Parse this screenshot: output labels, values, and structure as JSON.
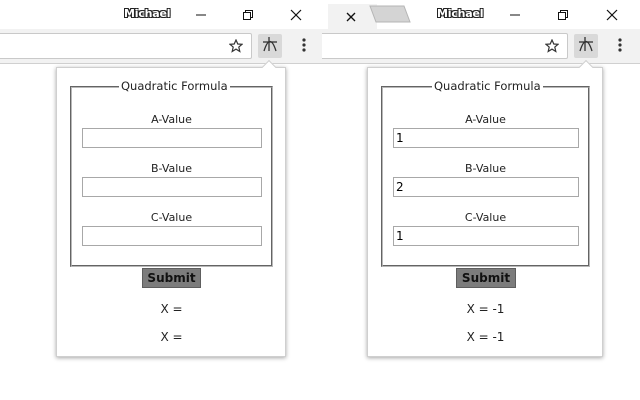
{
  "left_window": {
    "user_name": "Michael",
    "popup": {
      "legend": "Quadratic Formula",
      "a_label": "A-Value",
      "b_label": "B-Value",
      "c_label": "C-Value",
      "a_value": "",
      "b_value": "",
      "c_value": "",
      "submit_label": "Submit",
      "result_1": "X =",
      "result_2": "X ="
    }
  },
  "right_window": {
    "user_name": "Michael",
    "popup": {
      "legend": "Quadratic Formula",
      "a_label": "A-Value",
      "b_label": "B-Value",
      "c_label": "C-Value",
      "a_value": "1",
      "b_value": "2",
      "c_value": "1",
      "submit_label": "Submit",
      "result_1": "X = -1",
      "result_2": "X = -1"
    }
  },
  "icons": {
    "bookmark": "star-icon",
    "extension": "quadratic-extension-icon",
    "menu": "kebab-menu-icon",
    "minimize": "minimize-icon",
    "restore": "restore-icon",
    "close": "close-icon",
    "tab_close": "tab-close-icon"
  },
  "colors": {
    "toolbar_bg": "#f2f2f2",
    "extension_active_bg": "#d9d9d9",
    "submit_bg": "#7c7c7c"
  }
}
